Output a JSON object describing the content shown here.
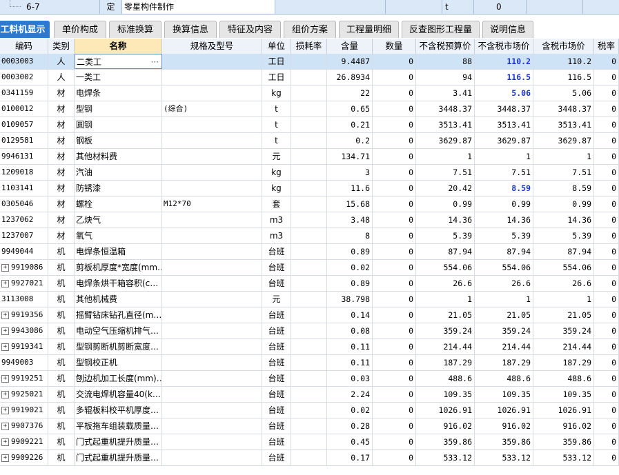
{
  "top_row": {
    "code": "6-7",
    "type": "定",
    "name": "零星构件制作",
    "unit": "t",
    "qty": "0"
  },
  "tabs": [
    {
      "label": "工料机显示",
      "active": true
    },
    {
      "label": "单价构成"
    },
    {
      "label": "标准换算"
    },
    {
      "label": "换算信息"
    },
    {
      "label": "特征及内容"
    },
    {
      "label": "组价方案"
    },
    {
      "label": "工程量明细"
    },
    {
      "label": "反查图形工程量"
    },
    {
      "label": "说明信息"
    }
  ],
  "columns": [
    "编码",
    "类别",
    "名称",
    "规格及型号",
    "单位",
    "损耗率",
    "含量",
    "数量",
    "不含税预算价",
    "不含税市场价",
    "含税市场价",
    "税率"
  ],
  "rows": [
    {
      "code": "0003003",
      "cat": "人",
      "name": "二类工",
      "spec": "",
      "unit": "工日",
      "loss": "",
      "content": "9.4487",
      "qty": "0",
      "budget": "88",
      "market": "110.2",
      "market_tax": "110.2",
      "tax": "0",
      "expand": false,
      "hl": true,
      "selected": true
    },
    {
      "code": "0003002",
      "cat": "人",
      "name": "一类工",
      "spec": "",
      "unit": "工日",
      "loss": "",
      "content": "26.8934",
      "qty": "0",
      "budget": "94",
      "market": "116.5",
      "market_tax": "116.5",
      "tax": "0",
      "expand": false,
      "hl": true
    },
    {
      "code": "0341159",
      "cat": "材",
      "name": "电焊条",
      "spec": "",
      "unit": "kg",
      "loss": "",
      "content": "22",
      "qty": "0",
      "budget": "3.41",
      "market": "5.06",
      "market_tax": "5.06",
      "tax": "0",
      "expand": false,
      "hl": true
    },
    {
      "code": "0100012",
      "cat": "材",
      "name": "型钢",
      "spec": "(综合)",
      "unit": "t",
      "loss": "",
      "content": "0.65",
      "qty": "0",
      "budget": "3448.37",
      "market": "3448.37",
      "market_tax": "3448.37",
      "tax": "0",
      "expand": false
    },
    {
      "code": "0109057",
      "cat": "材",
      "name": "圆钢",
      "spec": "",
      "unit": "t",
      "loss": "",
      "content": "0.21",
      "qty": "0",
      "budget": "3513.41",
      "market": "3513.41",
      "market_tax": "3513.41",
      "tax": "0",
      "expand": false
    },
    {
      "code": "0129581",
      "cat": "材",
      "name": "钢板",
      "spec": "",
      "unit": "t",
      "loss": "",
      "content": "0.2",
      "qty": "0",
      "budget": "3629.87",
      "market": "3629.87",
      "market_tax": "3629.87",
      "tax": "0",
      "expand": false
    },
    {
      "code": "9946131",
      "cat": "材",
      "name": "其他材料费",
      "spec": "",
      "unit": "元",
      "loss": "",
      "content": "134.71",
      "qty": "0",
      "budget": "1",
      "market": "1",
      "market_tax": "1",
      "tax": "0",
      "expand": false
    },
    {
      "code": "1209018",
      "cat": "材",
      "name": "汽油",
      "spec": "",
      "unit": "kg",
      "loss": "",
      "content": "3",
      "qty": "0",
      "budget": "7.51",
      "market": "7.51",
      "market_tax": "7.51",
      "tax": "0",
      "expand": false
    },
    {
      "code": "1103141",
      "cat": "材",
      "name": "防锈漆",
      "spec": "",
      "unit": "kg",
      "loss": "",
      "content": "11.6",
      "qty": "0",
      "budget": "20.42",
      "market": "8.59",
      "market_tax": "8.59",
      "tax": "0",
      "expand": false,
      "hl": true
    },
    {
      "code": "0305046",
      "cat": "材",
      "name": "螺栓",
      "spec": "M12*70",
      "unit": "套",
      "loss": "",
      "content": "15.68",
      "qty": "0",
      "budget": "0.99",
      "market": "0.99",
      "market_tax": "0.99",
      "tax": "0",
      "expand": false
    },
    {
      "code": "1237062",
      "cat": "材",
      "name": "乙炔气",
      "spec": "",
      "unit": "m3",
      "loss": "",
      "content": "3.48",
      "qty": "0",
      "budget": "14.36",
      "market": "14.36",
      "market_tax": "14.36",
      "tax": "0",
      "expand": false
    },
    {
      "code": "1237007",
      "cat": "材",
      "name": "氧气",
      "spec": "",
      "unit": "m3",
      "loss": "",
      "content": "8",
      "qty": "0",
      "budget": "5.39",
      "market": "5.39",
      "market_tax": "5.39",
      "tax": "0",
      "expand": false
    },
    {
      "code": "9949044",
      "cat": "机",
      "name": "电焊条恒温箱",
      "spec": "",
      "unit": "台班",
      "loss": "",
      "content": "0.89",
      "qty": "0",
      "budget": "87.94",
      "market": "87.94",
      "market_tax": "87.94",
      "tax": "0",
      "expand": false
    },
    {
      "code": "9919086",
      "cat": "机",
      "name": "剪板机厚度*宽度(mm…",
      "spec": "",
      "unit": "台班",
      "loss": "",
      "content": "0.02",
      "qty": "0",
      "budget": "554.06",
      "market": "554.06",
      "market_tax": "554.06",
      "tax": "0",
      "expand": true
    },
    {
      "code": "9927021",
      "cat": "机",
      "name": "电焊条烘干箱容积(c…",
      "spec": "",
      "unit": "台班",
      "loss": "",
      "content": "0.89",
      "qty": "0",
      "budget": "26.6",
      "market": "26.6",
      "market_tax": "26.6",
      "tax": "0",
      "expand": true
    },
    {
      "code": "3113008",
      "cat": "机",
      "name": "其他机械费",
      "spec": "",
      "unit": "元",
      "loss": "",
      "content": "38.798",
      "qty": "0",
      "budget": "1",
      "market": "1",
      "market_tax": "1",
      "tax": "0",
      "expand": false
    },
    {
      "code": "9919356",
      "cat": "机",
      "name": "摇臂钻床钻孔直径(m…",
      "spec": "",
      "unit": "台班",
      "loss": "",
      "content": "0.14",
      "qty": "0",
      "budget": "21.05",
      "market": "21.05",
      "market_tax": "21.05",
      "tax": "0",
      "expand": true
    },
    {
      "code": "9943086",
      "cat": "机",
      "name": "电动空气压缩机排气…",
      "spec": "",
      "unit": "台班",
      "loss": "",
      "content": "0.08",
      "qty": "0",
      "budget": "359.24",
      "market": "359.24",
      "market_tax": "359.24",
      "tax": "0",
      "expand": true
    },
    {
      "code": "9919341",
      "cat": "机",
      "name": "型钢剪断机剪断宽度…",
      "spec": "",
      "unit": "台班",
      "loss": "",
      "content": "0.11",
      "qty": "0",
      "budget": "214.44",
      "market": "214.44",
      "market_tax": "214.44",
      "tax": "0",
      "expand": true
    },
    {
      "code": "9949003",
      "cat": "机",
      "name": "型钢校正机",
      "spec": "",
      "unit": "台班",
      "loss": "",
      "content": "0.11",
      "qty": "0",
      "budget": "187.29",
      "market": "187.29",
      "market_tax": "187.29",
      "tax": "0",
      "expand": false
    },
    {
      "code": "9919251",
      "cat": "机",
      "name": "刨边机加工长度(mm)…",
      "spec": "",
      "unit": "台班",
      "loss": "",
      "content": "0.03",
      "qty": "0",
      "budget": "488.6",
      "market": "488.6",
      "market_tax": "488.6",
      "tax": "0",
      "expand": true
    },
    {
      "code": "9925021",
      "cat": "机",
      "name": "交流电焊机容量40(k…",
      "spec": "",
      "unit": "台班",
      "loss": "",
      "content": "2.24",
      "qty": "0",
      "budget": "109.35",
      "market": "109.35",
      "market_tax": "109.35",
      "tax": "0",
      "expand": true
    },
    {
      "code": "9919021",
      "cat": "机",
      "name": "多辊板料校平机厚度…",
      "spec": "",
      "unit": "台班",
      "loss": "",
      "content": "0.02",
      "qty": "0",
      "budget": "1026.91",
      "market": "1026.91",
      "market_tax": "1026.91",
      "tax": "0",
      "expand": true
    },
    {
      "code": "9907376",
      "cat": "机",
      "name": "平板拖车组装载质量…",
      "spec": "",
      "unit": "台班",
      "loss": "",
      "content": "0.28",
      "qty": "0",
      "budget": "916.02",
      "market": "916.02",
      "market_tax": "916.02",
      "tax": "0",
      "expand": true
    },
    {
      "code": "9909221",
      "cat": "机",
      "name": "门式起重机提升质量…",
      "spec": "",
      "unit": "台班",
      "loss": "",
      "content": "0.45",
      "qty": "0",
      "budget": "359.86",
      "market": "359.86",
      "market_tax": "359.86",
      "tax": "0",
      "expand": true
    },
    {
      "code": "9909226",
      "cat": "机",
      "name": "门式起重机提升质量…",
      "spec": "",
      "unit": "台班",
      "loss": "",
      "content": "0.17",
      "qty": "0",
      "budget": "533.12",
      "market": "533.12",
      "market_tax": "533.12",
      "tax": "0",
      "expand": true
    }
  ],
  "colors": {
    "accent": "#2b79d1",
    "highlight_value": "#1a33d6",
    "selected_row": "#cfe3f7",
    "header_selected": "#fde9b8"
  }
}
